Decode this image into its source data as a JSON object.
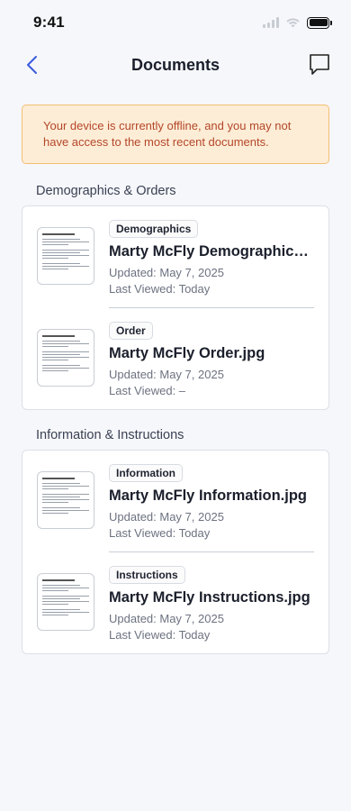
{
  "status_bar": {
    "time": "9:41"
  },
  "nav": {
    "title": "Documents"
  },
  "banner": {
    "text": "Your device is currently offline, and you may not have access to the most recent documents."
  },
  "sections": [
    {
      "title": "Demographics & Orders",
      "documents": [
        {
          "tag": "Demographics",
          "name": "Marty McFly Demographics.jpg",
          "updated": "Updated: May 7, 2025",
          "last_viewed": "Last Viewed: Today"
        },
        {
          "tag": "Order",
          "name": "Marty McFly Order.jpg",
          "updated": "Updated: May 7, 2025",
          "last_viewed": "Last Viewed: –"
        }
      ]
    },
    {
      "title": "Information & Instructions",
      "documents": [
        {
          "tag": "Information",
          "name": "Marty McFly Information.jpg",
          "updated": "Updated: May 7, 2025",
          "last_viewed": "Last Viewed: Today"
        },
        {
          "tag": "Instructions",
          "name": "Marty McFly Instructions.jpg",
          "updated": "Updated: May 7, 2025",
          "last_viewed": "Last Viewed: Today"
        }
      ]
    }
  ],
  "icons": {
    "back": "chevron-left-icon",
    "chat": "chat-bubble-icon",
    "signal": "cellular-signal-icon",
    "wifi": "wifi-icon",
    "battery": "battery-icon"
  },
  "colors": {
    "accent": "#3b5bdb",
    "banner_bg": "#fdecd6",
    "banner_border": "#f2bf73",
    "banner_text": "#b4472a"
  }
}
